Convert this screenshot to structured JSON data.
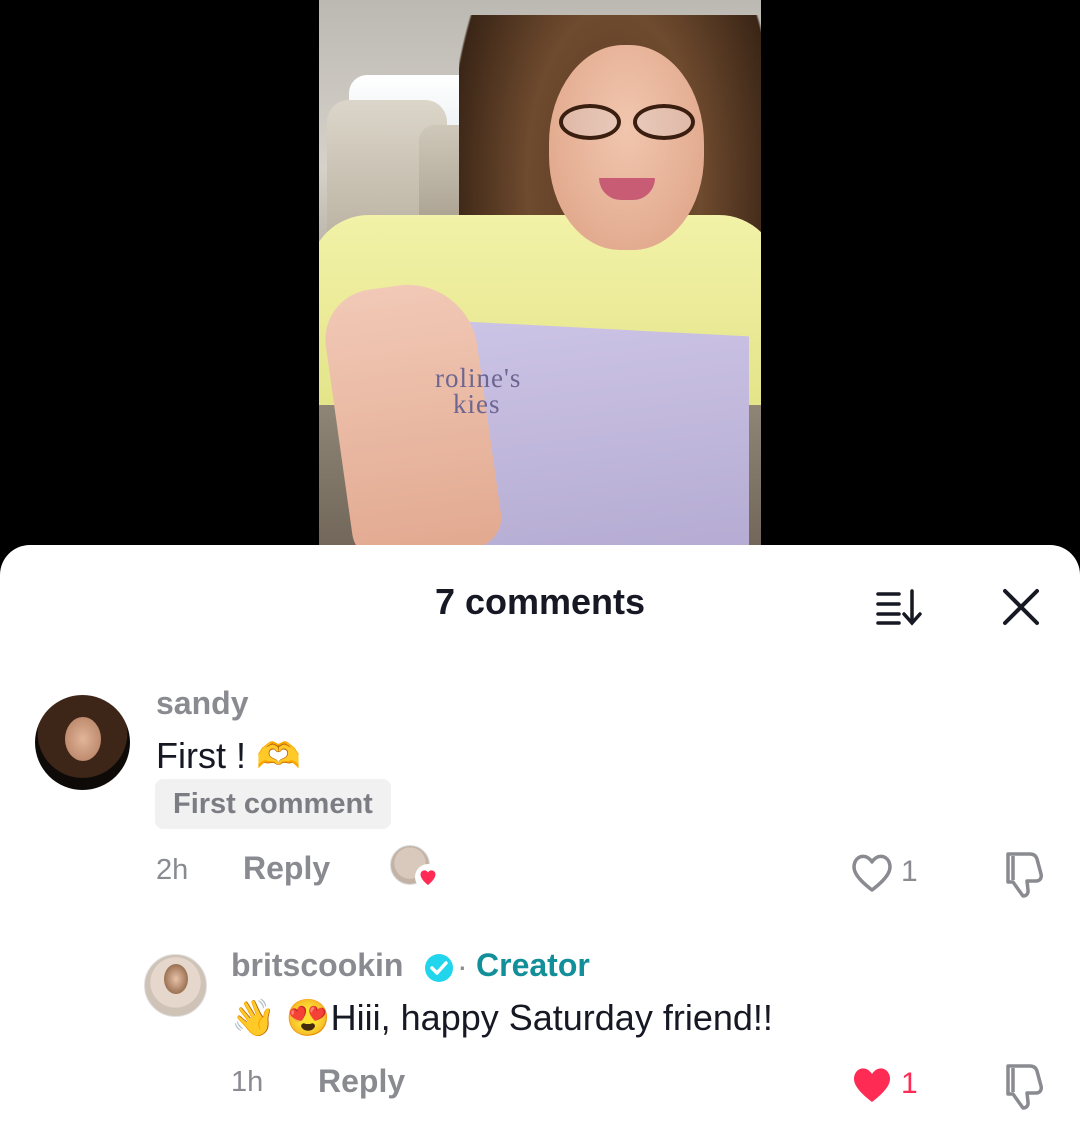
{
  "video": {
    "brand_line1": "roline's",
    "brand_line2": "kies"
  },
  "sheet": {
    "title": "7 comments",
    "sort_icon": "sort-icon",
    "close_icon": "close-icon"
  },
  "comments": [
    {
      "username": "sandy",
      "text": "First ! 🫶",
      "badge": "First comment",
      "time": "2h",
      "reply_label": "Reply",
      "likes": "1",
      "liked_by_creator": true,
      "liked": false
    },
    {
      "username": "britscookin",
      "verified": true,
      "separator": "·",
      "creator_label": "Creator",
      "text": "👋 😍Hiii, happy Saturday friend!!",
      "time": "1h",
      "reply_label": "Reply",
      "likes": "1",
      "liked": true
    }
  ],
  "colors": {
    "accent_red": "#fe2c55",
    "creator_teal": "#138f9a",
    "verified_blue": "#20d5ec",
    "text_primary": "#161823",
    "text_secondary": "#8a8b91"
  }
}
